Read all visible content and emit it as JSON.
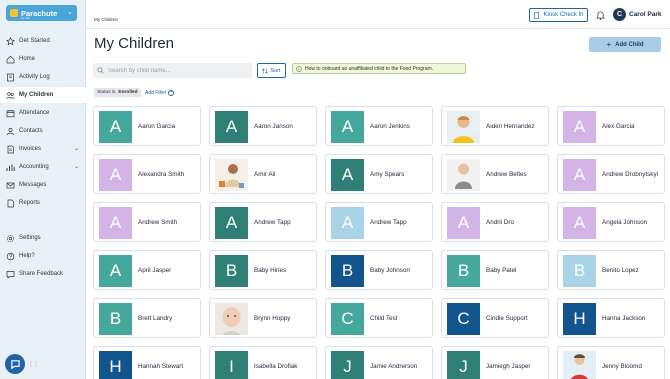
{
  "app": {
    "brand_name": "Parachute",
    "brand_sub": "by Kisi",
    "breadcrumb": "My Children",
    "kiosk_label": "Kiosk Check In",
    "user_initial": "C",
    "user_name": "Carol Park"
  },
  "sidebar": {
    "items": [
      {
        "label": "Get Started",
        "icon": "star-icon"
      },
      {
        "label": "Home",
        "icon": "home-icon"
      },
      {
        "label": "Activity Log",
        "icon": "book-icon"
      },
      {
        "label": "My Children",
        "icon": "people-icon",
        "active": true
      },
      {
        "label": "Attendance",
        "icon": "calendar-icon"
      },
      {
        "label": "Contacts",
        "icon": "contact-icon"
      },
      {
        "label": "Invoices",
        "icon": "invoice-icon",
        "chevron": true
      },
      {
        "label": "Accounting",
        "icon": "chart-icon",
        "chevron": true
      },
      {
        "label": "Messages",
        "icon": "mail-icon"
      },
      {
        "label": "Reports",
        "icon": "report-icon"
      },
      {
        "label": "Settings",
        "icon": "gear-icon"
      },
      {
        "label": "Help?",
        "icon": "help-icon"
      },
      {
        "label": "Share Feedback",
        "icon": "feedback-icon"
      }
    ]
  },
  "main": {
    "title": "My Children",
    "add_child_label": "Add Child",
    "search_placeholder": "Search by child name...",
    "sort_label": "Sort",
    "onboard_text": "How to onboard an unaffiliated child to the Food Program.",
    "status_label": "Status is",
    "status_value": "Enrolled",
    "add_filter_label": "Add Filter"
  },
  "colors": {
    "accent": "#1f64a8",
    "teal": "#45a89b",
    "teal_dark": "#2f7f76",
    "lilac": "#d2b4e6",
    "light_blue": "#a9d3e6",
    "navy": "#11558c"
  },
  "children": [
    {
      "name": "Aaron Garcia",
      "initial": "A",
      "color": "#45a89b"
    },
    {
      "name": "Aaron Janson",
      "initial": "A",
      "color": "#2f7f76"
    },
    {
      "name": "Aaron Jenkins",
      "initial": "A",
      "color": "#45a89b"
    },
    {
      "name": "Aiden Hernandez",
      "photo": "boy-yellow"
    },
    {
      "name": "Alex Garcia",
      "initial": "A",
      "color": "#d2b4e6"
    },
    {
      "name": "Alexandra Smith",
      "initial": "A",
      "color": "#d2b4e6"
    },
    {
      "name": "Amir Ali",
      "photo": "toddler-blocks"
    },
    {
      "name": "Amy Spears",
      "initial": "A",
      "color": "#2f7f76"
    },
    {
      "name": "Andrew Betles",
      "photo": "baby-sitting"
    },
    {
      "name": "Andrew Drobnytskyi",
      "initial": "A",
      "color": "#d2b4e6"
    },
    {
      "name": "Andrew Smith",
      "initial": "A",
      "color": "#d2b4e6"
    },
    {
      "name": "Andrew Tapp",
      "initial": "A",
      "color": "#2f7f76"
    },
    {
      "name": "Andrew Tapp",
      "initial": "A",
      "color": "#a9d3e6"
    },
    {
      "name": "Andrii Dro",
      "initial": "A",
      "color": "#d2b4e6"
    },
    {
      "name": "Angela Johnson",
      "initial": "A",
      "color": "#d2b4e6"
    },
    {
      "name": "April Jasper",
      "initial": "A",
      "color": "#45a89b"
    },
    {
      "name": "Baby Hines",
      "initial": "B",
      "color": "#2f7f76"
    },
    {
      "name": "Baby Johnson",
      "initial": "B",
      "color": "#11558c"
    },
    {
      "name": "Baby Patel",
      "initial": "B",
      "color": "#45a89b"
    },
    {
      "name": "Benito Lopez",
      "initial": "B",
      "color": "#a9d3e6"
    },
    {
      "name": "Brett Landry",
      "initial": "B",
      "color": "#45a89b"
    },
    {
      "name": "Brynn Hoppy",
      "photo": "baby-face"
    },
    {
      "name": "Child Test",
      "initial": "C",
      "color": "#45a89b"
    },
    {
      "name": "Cindie Support",
      "initial": "C",
      "color": "#11558c"
    },
    {
      "name": "Hanna Jackson",
      "initial": "H",
      "color": "#11558c"
    },
    {
      "name": "Hannah Stewart",
      "initial": "H",
      "color": "#11558c"
    },
    {
      "name": "Isabella Drofiak",
      "initial": "I",
      "color": "#2f7f76"
    },
    {
      "name": "Jamie Andrerson",
      "initial": "J",
      "color": "#2f7f76"
    },
    {
      "name": "Jamiegh Jasper",
      "initial": "J",
      "color": "#2f7f76"
    },
    {
      "name": "Jenny Bloomd",
      "photo": "girl-red"
    }
  ]
}
